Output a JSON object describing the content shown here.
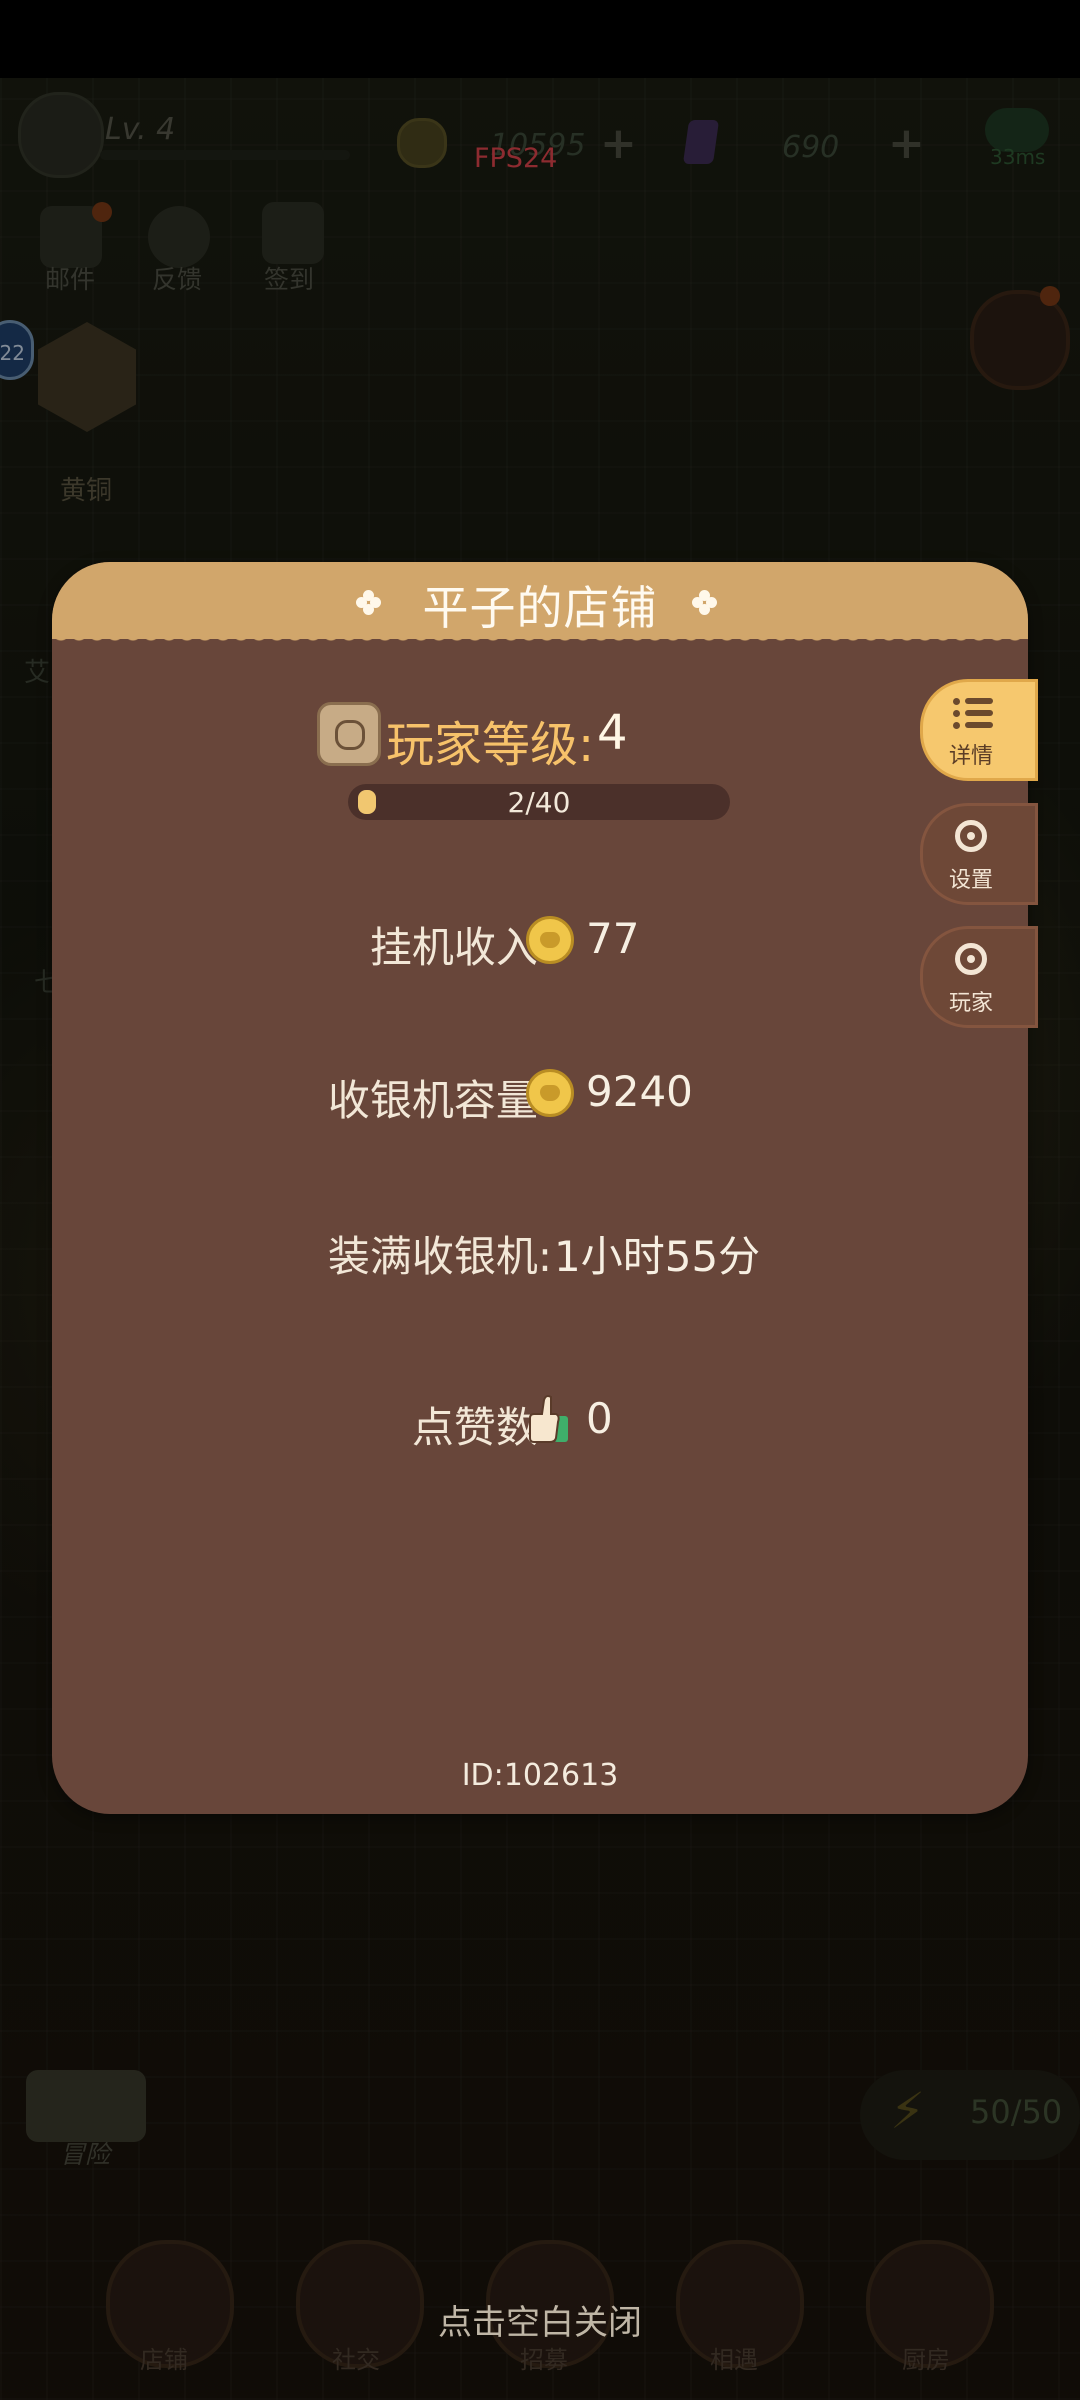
{
  "hud": {
    "level": "Lv. 4",
    "coins": "10595",
    "gems": "690",
    "fps": "FPS24",
    "ping": "33ms"
  },
  "top_menu": {
    "mail": "邮件",
    "feedback": "反馈",
    "signin": "签到"
  },
  "rank": {
    "level_badge": "22",
    "name": "黄铜"
  },
  "left_labels": {
    "a": "艾",
    "b": "七"
  },
  "side_map": {
    "label": "冒险"
  },
  "energy": {
    "value": "50/50"
  },
  "bottom_nav": [
    "店铺",
    "社交",
    "招募",
    "相遇",
    "厨房"
  ],
  "close_hint": "点击空白关闭",
  "panel": {
    "title": "平子的店铺",
    "level_label": "玩家等级:",
    "level_value": "4",
    "xp_text": "2/40",
    "xp_progress": 0.05,
    "idle_income_label": "挂机收入:",
    "idle_income_value": "77",
    "register_capacity_label": "收银机容量:",
    "register_capacity_value": "9240",
    "fill_register_label": "装满收银机:",
    "fill_register_value": "1小时55分",
    "likes_label": "点赞数:",
    "likes_value": "0",
    "id": "ID:102613",
    "tabs": {
      "details": "详情",
      "settings": "设置",
      "player": "玩家"
    }
  },
  "colors": {
    "panel_bg": "#68463a",
    "panel_header": "#d1a66b",
    "level_accent": "#f7c26a",
    "active_tab": "#f6c86e"
  }
}
